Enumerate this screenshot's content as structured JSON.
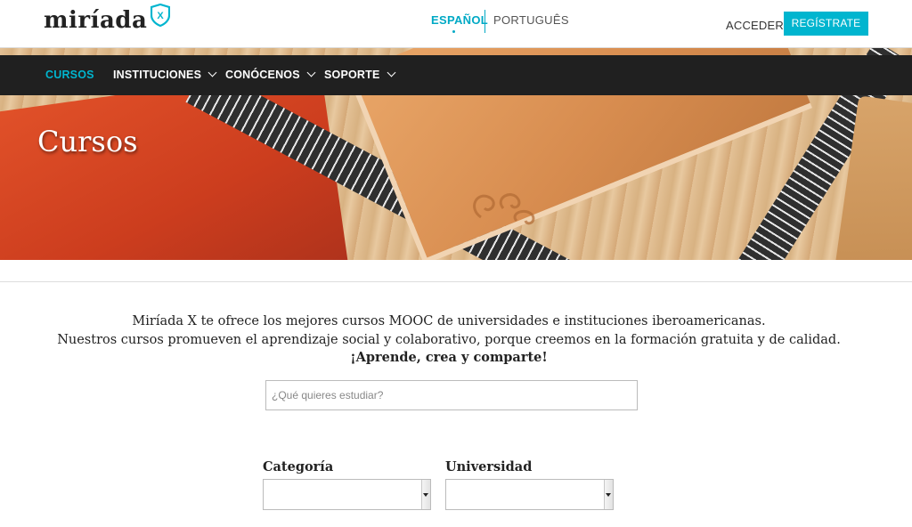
{
  "brand": {
    "name": "miríada",
    "badge": "X",
    "accent_color": "#00b5cf"
  },
  "header": {
    "languages": [
      {
        "label": "ESPAÑOL",
        "active": true
      },
      {
        "label": "PORTUGUÊS",
        "active": false
      }
    ],
    "login_label": "ACCEDER",
    "register_label": "REGÍSTRATE"
  },
  "nav": {
    "items": [
      {
        "label": "CURSOS",
        "active": true,
        "icon": ""
      },
      {
        "label": "INSTITUCIONES",
        "active": false,
        "icon": "chevron-down-icon"
      },
      {
        "label": "CONÓCENOS",
        "active": false,
        "icon": "chevron-down-icon"
      },
      {
        "label": "SOPORTE",
        "active": false,
        "icon": "chevron-down-icon"
      }
    ]
  },
  "hero": {
    "title": "Cursos"
  },
  "intro": {
    "line1": "Miríada X te ofrece los mejores cursos MOOC de universidades e instituciones iberoamericanas.",
    "line2": "Nuestros cursos promueven el aprendizaje social y colaborativo, porque creemos en  la formación gratuita y de calidad.",
    "line3": "¡Aprende, crea y comparte!"
  },
  "search": {
    "placeholder": "¿Qué quieres estudiar?",
    "value": ""
  },
  "filters": {
    "category": {
      "label": "Categoría",
      "selected": ""
    },
    "university": {
      "label": "Universidad",
      "selected": ""
    }
  }
}
